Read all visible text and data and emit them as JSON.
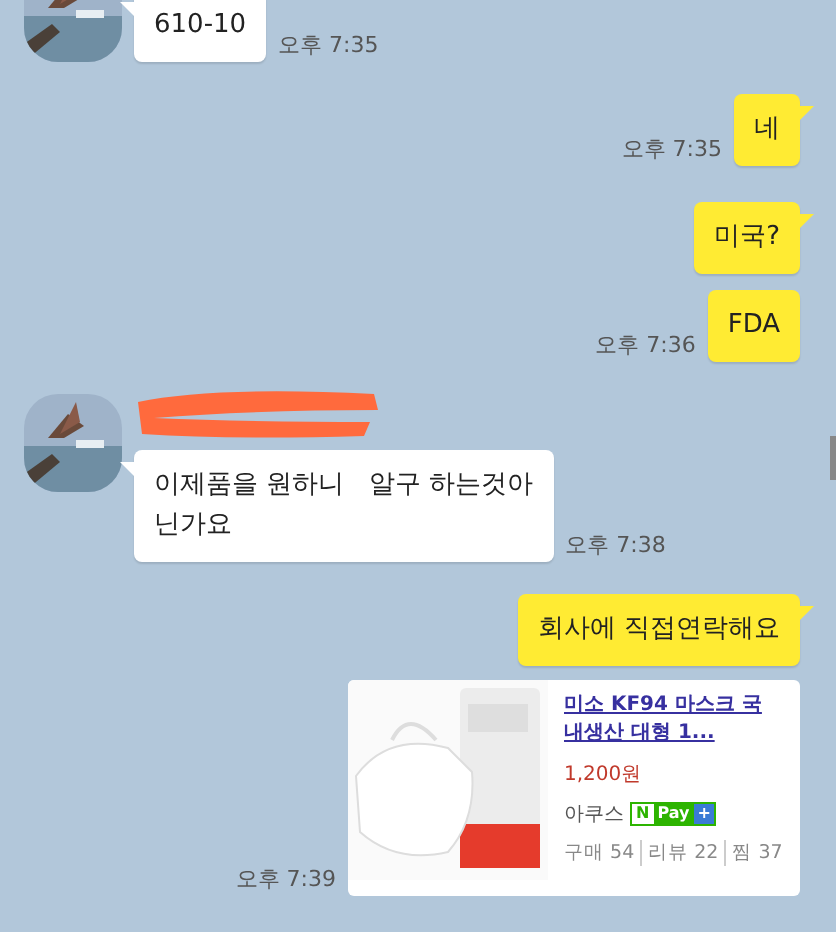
{
  "messages": [
    {
      "kind": "incoming",
      "lines": [
        "610-10"
      ],
      "time": "오후 7:35"
    },
    {
      "kind": "outgoing",
      "lines": [
        "네"
      ],
      "time": "오후 7:35",
      "tail": true
    },
    {
      "kind": "outgoing",
      "lines": [
        "미국?"
      ],
      "tail": true
    },
    {
      "kind": "outgoing",
      "lines": [
        "FDA"
      ],
      "time": "오후 7:36",
      "tail": false
    },
    {
      "kind": "incoming",
      "name_redacted": true,
      "lines": [
        "이제품을 원하니   알구 하는것아",
        "닌가요"
      ],
      "time": "오후 7:38"
    },
    {
      "kind": "outgoing",
      "lines": [
        "회사에 직접연락해요"
      ],
      "tail": true
    },
    {
      "kind": "product",
      "image": {
        "kind": "picture"
      },
      "title_lines": [
        "미소 KF94 마스크 국",
        "내생산 대형 1..."
      ],
      "price": "1,200원",
      "seller": "아쿠스",
      "pay_badge": [
        "N",
        "Pay",
        "+"
      ],
      "stats": [
        {
          "label": "구매",
          "value": "54"
        },
        {
          "label": "리뷰",
          "value": "22"
        },
        {
          "label": "찜",
          "value": "37"
        }
      ],
      "time": "오후 7:39"
    }
  ]
}
